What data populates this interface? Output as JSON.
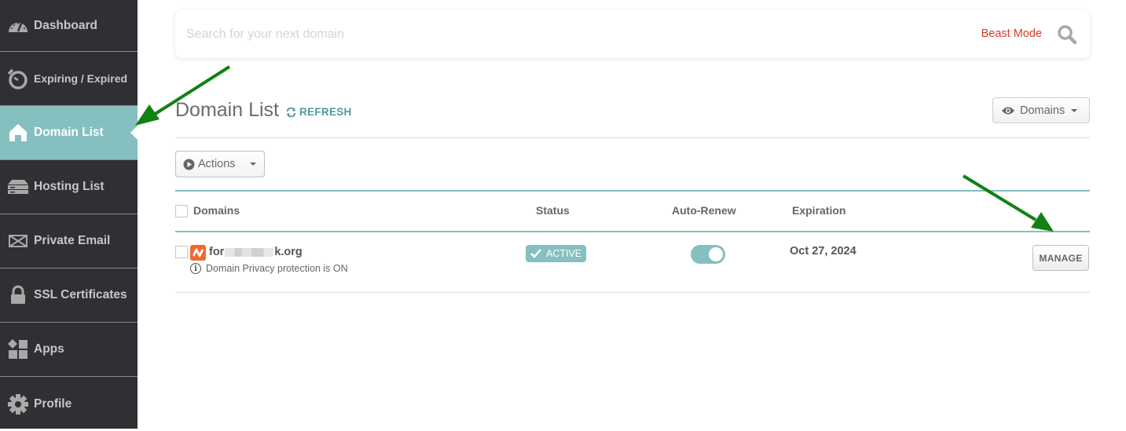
{
  "sidebar": {
    "items": [
      {
        "label": "Dashboard",
        "icon": "dashboard-gauge-icon",
        "active": false
      },
      {
        "label": "Expiring / Expired",
        "icon": "stopwatch-icon",
        "active": false
      },
      {
        "label": "Domain List",
        "icon": "home-icon",
        "active": true
      },
      {
        "label": "Hosting List",
        "icon": "server-icon",
        "active": false
      },
      {
        "label": "Private Email",
        "icon": "envelope-icon",
        "active": false
      },
      {
        "label": "SSL Certificates",
        "icon": "lock-icon",
        "active": false
      },
      {
        "label": "Apps",
        "icon": "apps-icon",
        "active": false
      },
      {
        "label": "Profile",
        "icon": "gear-icon",
        "active": false
      }
    ]
  },
  "search": {
    "placeholder": "Search for your next domain",
    "value": "",
    "beast_mode_label": "Beast Mode"
  },
  "header": {
    "title": "Domain List",
    "refresh_label": "REFRESH",
    "view_dropdown_label": "Domains"
  },
  "toolbar": {
    "actions_label": "Actions"
  },
  "table": {
    "columns": [
      "Domains",
      "Status",
      "Auto-Renew",
      "Expiration"
    ],
    "rows": [
      {
        "domain_prefix": "for",
        "domain_suffix": "k.org",
        "domain_obscured": true,
        "privacy_note": "Domain Privacy protection is ON",
        "status": "ACTIVE",
        "auto_renew": true,
        "expiration": "Oct 27, 2024",
        "action_label": "MANAGE"
      }
    ]
  },
  "colors": {
    "sidebar_bg": "#2f3033",
    "accent_teal": "#86bfbf",
    "beast_mode_red": "#d33a2c",
    "annotation_arrow": "#138013",
    "favicon_orange": "#f06a2f"
  }
}
